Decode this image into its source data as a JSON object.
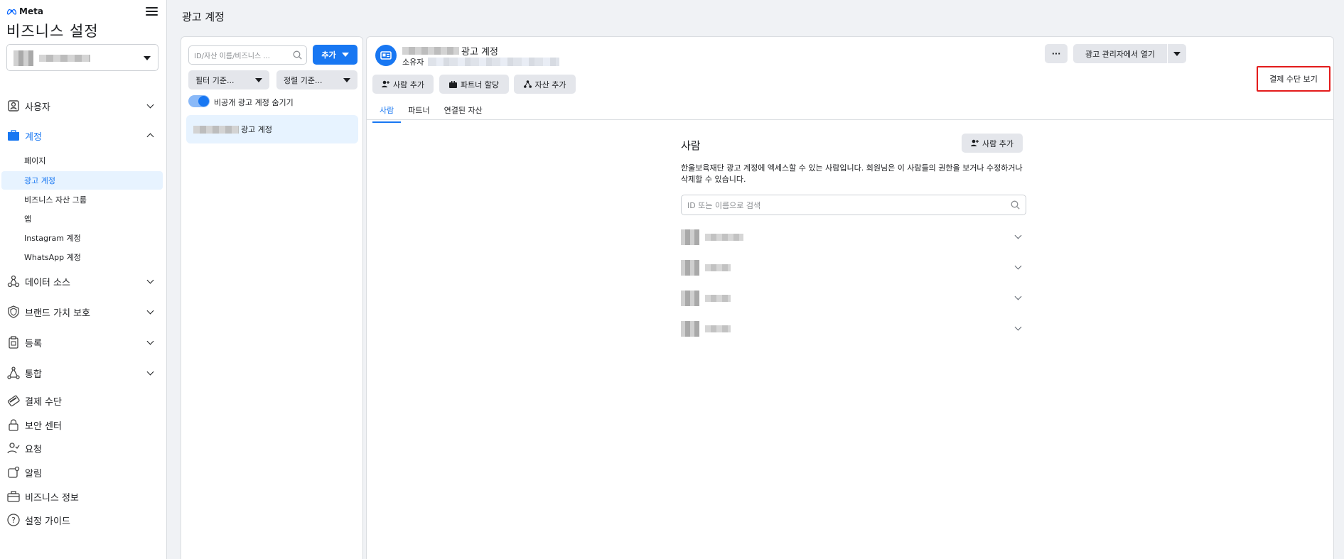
{
  "brand": {
    "logo_text": "Meta",
    "accent": "#1877f2",
    "highlight": "#e31b1b"
  },
  "sidebar": {
    "title": "비즈니스 설정",
    "items": [
      {
        "label": "사용자",
        "icon": "users-icon"
      },
      {
        "label": "계정",
        "icon": "briefcase-icon"
      },
      {
        "label": "데이터 소스",
        "icon": "data-sources-icon"
      },
      {
        "label": "브랜드 가치 보호",
        "icon": "shield-icon"
      },
      {
        "label": "등록",
        "icon": "clipboard-icon"
      },
      {
        "label": "통합",
        "icon": "integrations-icon"
      },
      {
        "label": "결제 수단",
        "icon": "credit-card-icon"
      },
      {
        "label": "보안 센터",
        "icon": "lock-icon"
      },
      {
        "label": "요청",
        "icon": "person-check-icon"
      },
      {
        "label": "알림",
        "icon": "notification-icon"
      },
      {
        "label": "비즈니스 정보",
        "icon": "business-info-icon"
      },
      {
        "label": "설정 가이드",
        "icon": "help-icon"
      }
    ],
    "sub_items": [
      "페이지",
      "광고 계정",
      "비즈니스 자산 그룹",
      "앱",
      "Instagram 계정",
      "WhatsApp 계정"
    ]
  },
  "header": {
    "title": "광고 계정"
  },
  "list_panel": {
    "search_placeholder": "ID/자산 이름/비즈니스 ...",
    "add_label": "추가",
    "filter_label": "필터 기준...",
    "sort_label": "정렬 기준...",
    "toggle_label": "비공개 광고 계정 숨기기",
    "toggle_on": true,
    "selected_item_label": "광고 계정"
  },
  "detail": {
    "account_title": "광고 계정",
    "owner_label": "소유자",
    "more_label": "···",
    "open_ads_manager_label": "광고 관리자에서 열기",
    "view_payment_label": "결제 수단 보기",
    "actions": [
      "사람 추가",
      "파트너 할당",
      "자산 추가"
    ],
    "tabs": [
      "사람",
      "파트너",
      "연결된 자산"
    ],
    "active_tab": 0,
    "people": {
      "title": "사람",
      "add_label": "사람 추가",
      "description": "한울보육재단 광고 계정에 엑세스할 수 있는 사람입니다. 회원님은 이 사람들의 권한을 보거나 수정하거나 삭제할 수 있습니다.",
      "search_placeholder": "ID 또는 이름으로 검색",
      "count": 4
    }
  }
}
